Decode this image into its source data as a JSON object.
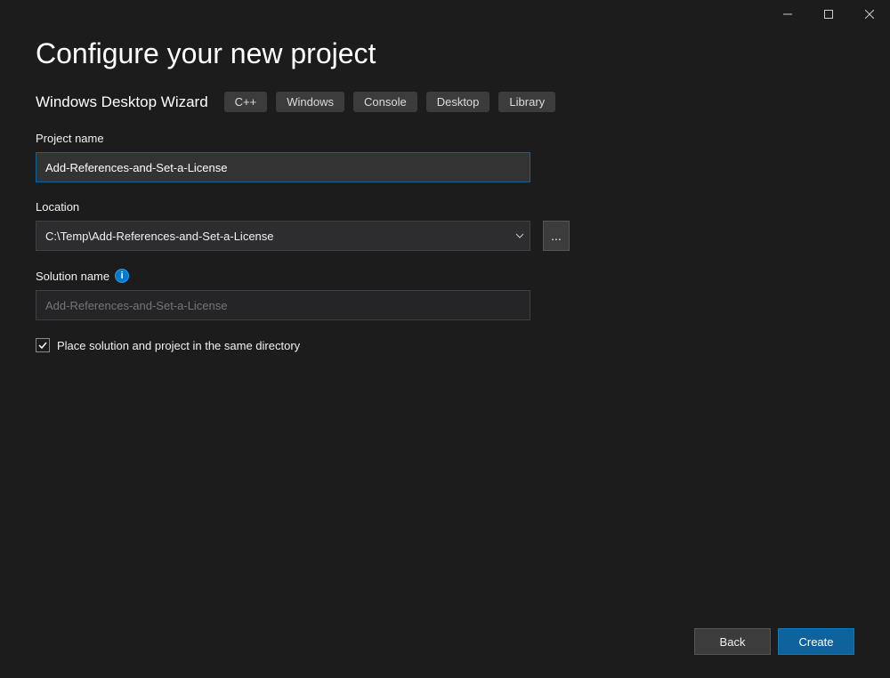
{
  "window": {
    "title": "Configure your new project",
    "template_name": "Windows Desktop Wizard",
    "tags": [
      "C++",
      "Windows",
      "Console",
      "Desktop",
      "Library"
    ]
  },
  "fields": {
    "project_name": {
      "label": "Project name",
      "value": "Add-References-and-Set-a-License"
    },
    "location": {
      "label": "Location",
      "value": "C:\\Temp\\Add-References-and-Set-a-License",
      "browse_label": "..."
    },
    "solution_name": {
      "label": "Solution name",
      "placeholder": "Add-References-and-Set-a-License"
    },
    "same_dir_checkbox": {
      "label": "Place solution and project in the same directory",
      "checked": true
    }
  },
  "footer": {
    "back": "Back",
    "create": "Create"
  },
  "icons": {
    "info": "i"
  }
}
